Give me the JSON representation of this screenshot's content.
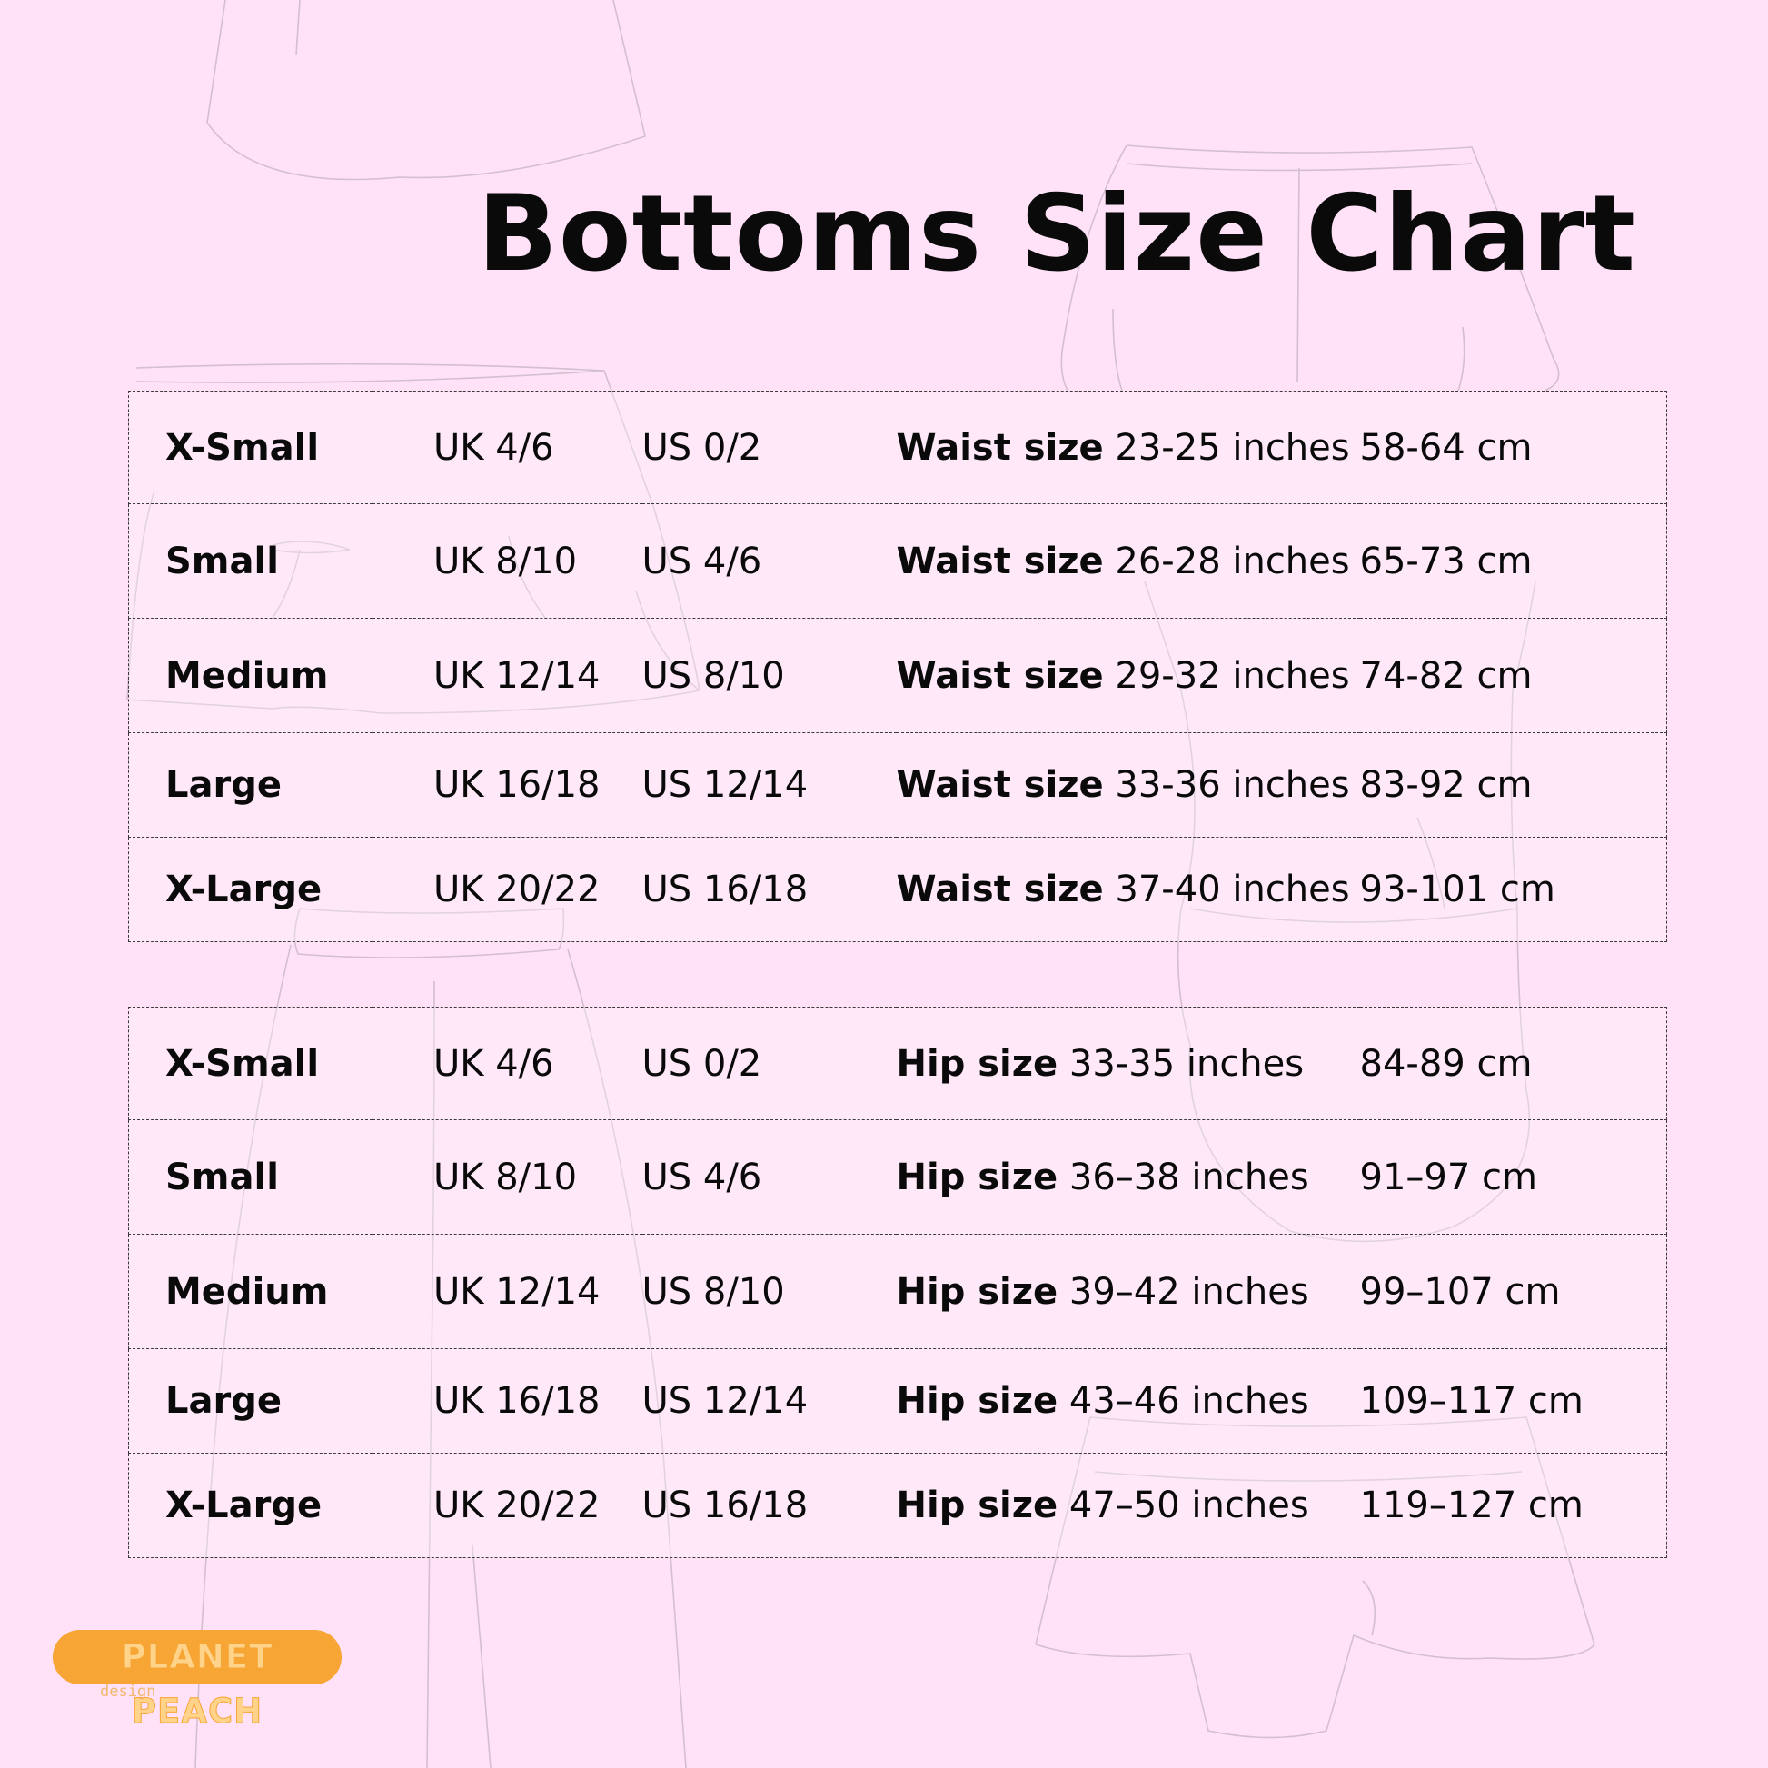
{
  "title": "Bottoms Size Chart",
  "waist_rows": [
    {
      "size": "X-Small",
      "uk": "UK 4/6",
      "us": "US 0/2",
      "label": "Waist size",
      "inches": "23-25 inches",
      "cm": "58-64 cm"
    },
    {
      "size": "Small",
      "uk": "UK 8/10",
      "us": "US 4/6",
      "label": "Waist size",
      "inches": "26-28 inches",
      "cm": "65-73 cm"
    },
    {
      "size": "Medium",
      "uk": "UK 12/14",
      "us": "US 8/10",
      "label": "Waist size",
      "inches": "29-32 inches",
      "cm": "74-82 cm"
    },
    {
      "size": "Large",
      "uk": "UK 16/18",
      "us": "US 12/14",
      "label": "Waist size",
      "inches": "33-36 inches",
      "cm": "83-92 cm"
    },
    {
      "size": "X-Large",
      "uk": "UK 20/22",
      "us": "US 16/18",
      "label": "Waist size",
      "inches": "37-40 inches",
      "cm": "93-101 cm"
    }
  ],
  "hip_rows": [
    {
      "size": "X-Small",
      "uk": "UK 4/6",
      "us": "US 0/2",
      "label": "Hip size",
      "inches": "33-35 inches",
      "cm": "84-89 cm"
    },
    {
      "size": "Small",
      "uk": "UK 8/10",
      "us": "US 4/6",
      "label": "Hip size",
      "inches": "36–38 inches",
      "cm": "91–97 cm"
    },
    {
      "size": "Medium",
      "uk": "UK 12/14",
      "us": "US 8/10",
      "label": "Hip size",
      "inches": "39–42 inches",
      "cm": "99–107 cm"
    },
    {
      "size": "Large",
      "uk": "UK 16/18",
      "us": "US 12/14",
      "label": "Hip size",
      "inches": "43–46 inches",
      "cm": "109–117 cm"
    },
    {
      "size": "X-Large",
      "uk": "UK 20/22",
      "us": "US 16/18",
      "label": "Hip size",
      "inches": "47–50 inches",
      "cm": "119–127 cm"
    }
  ],
  "logo": {
    "name": "PLANET PEACH",
    "sub": "design",
    "color": "#f7a534"
  },
  "colors": {
    "background": "#ffe2f8",
    "text": "#0a0a0a",
    "border": "#3a3a3a"
  }
}
